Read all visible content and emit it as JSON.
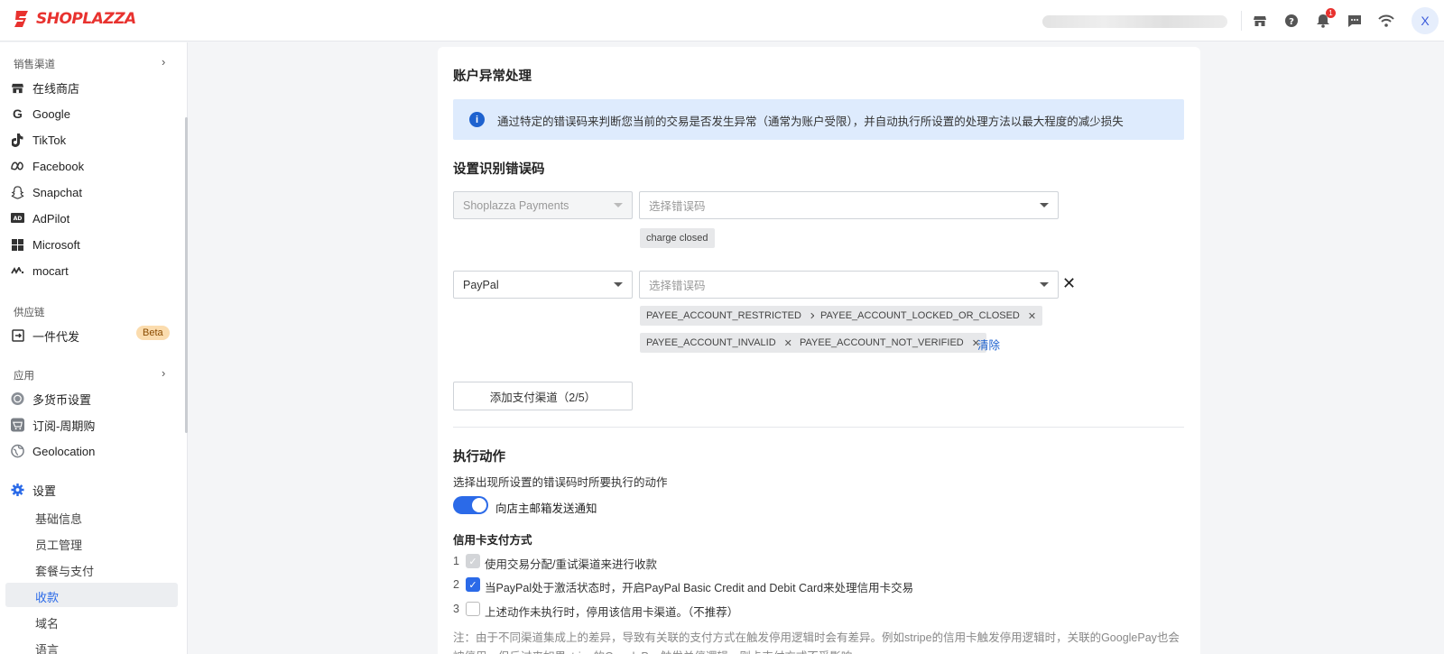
{
  "topbar": {
    "brand": "SHOPLAZZA",
    "notification_count": "1",
    "avatar_letter": "X",
    "icons": [
      "store-icon",
      "help-icon",
      "bell-icon",
      "chat-icon",
      "wifi-icon"
    ]
  },
  "sidebar": {
    "sales_channels_title": "销售渠道",
    "channels": [
      {
        "label": "在线商店",
        "icon": "store-icon"
      },
      {
        "label": "Google",
        "icon": "google-icon"
      },
      {
        "label": "TikTok",
        "icon": "tiktok-icon"
      },
      {
        "label": "Facebook",
        "icon": "meta-icon"
      },
      {
        "label": "Snapchat",
        "icon": "snapchat-icon"
      },
      {
        "label": "AdPilot",
        "icon": "adpilot-icon"
      },
      {
        "label": "Microsoft",
        "icon": "microsoft-icon"
      },
      {
        "label": "mocart",
        "icon": "mocart-icon"
      }
    ],
    "supply_title": "供应链",
    "dropship_label": "一件代发",
    "beta_label": "Beta",
    "apps_title": "应用",
    "apps": [
      {
        "label": "多货币设置",
        "icon": "currency-icon"
      },
      {
        "label": "订阅-周期购",
        "icon": "subscription-icon"
      },
      {
        "label": "Geolocation",
        "icon": "geolocation-icon"
      }
    ],
    "settings_label": "设置",
    "settings_items": [
      "基础信息",
      "员工管理",
      "套餐与支付",
      "收款",
      "域名",
      "语言"
    ],
    "active_item": "收款"
  },
  "main": {
    "title": "账户异常处理",
    "alert_text": "通过特定的错误码来判断您当前的交易是否发生异常（通常为账户受限），并自动执行所设置的处理方法以最大程度的减少损失",
    "error_code_title": "设置识别错误码",
    "rows": [
      {
        "channel": "Shoplazza Payments",
        "code_placeholder": "选择错误码",
        "tags": [
          "charge closed"
        ]
      },
      {
        "channel": "PayPal",
        "code_placeholder": "选择错误码",
        "tags": [
          "PAYEE_ACCOUNT_RESTRICTED",
          "PAYEE_ACCOUNT_LOCKED_OR_CLOSED",
          "PAYEE_ACCOUNT_INVALID",
          "PAYEE_ACCOUNT_NOT_VERIFIED"
        ],
        "clear_label": "清除"
      }
    ],
    "add_channel_label": "添加支付渠道（2/5）",
    "action_title": "执行动作",
    "action_desc": "选择出现所设置的错误码时所要执行的动作",
    "toggle_label": "向店主邮箱发送通知",
    "toggle_on": true,
    "card_title": "信用卡支付方式",
    "card_options": [
      {
        "num": "1",
        "label": "使用交易分配/重试渠道来进行收款",
        "state": "disabled-checked"
      },
      {
        "num": "2",
        "label": "当PayPal处于激活状态时，开启PayPal Basic Credit and Debit Card来处理信用卡交易",
        "state": "checked"
      },
      {
        "num": "3",
        "label": "上述动作未执行时，停用该信用卡渠道。（不推荐）",
        "state": "unchecked"
      }
    ],
    "note": "注：由于不同渠道集成上的差异，导致有关联的支付方式在触发停用逻辑时会有差异。例如stripe的信用卡触发停用逻辑时，关联的GooglePay也会被停用，但反过来如果stripe的GooglePay触发关停逻辑，则卡支付方式不受影响"
  }
}
